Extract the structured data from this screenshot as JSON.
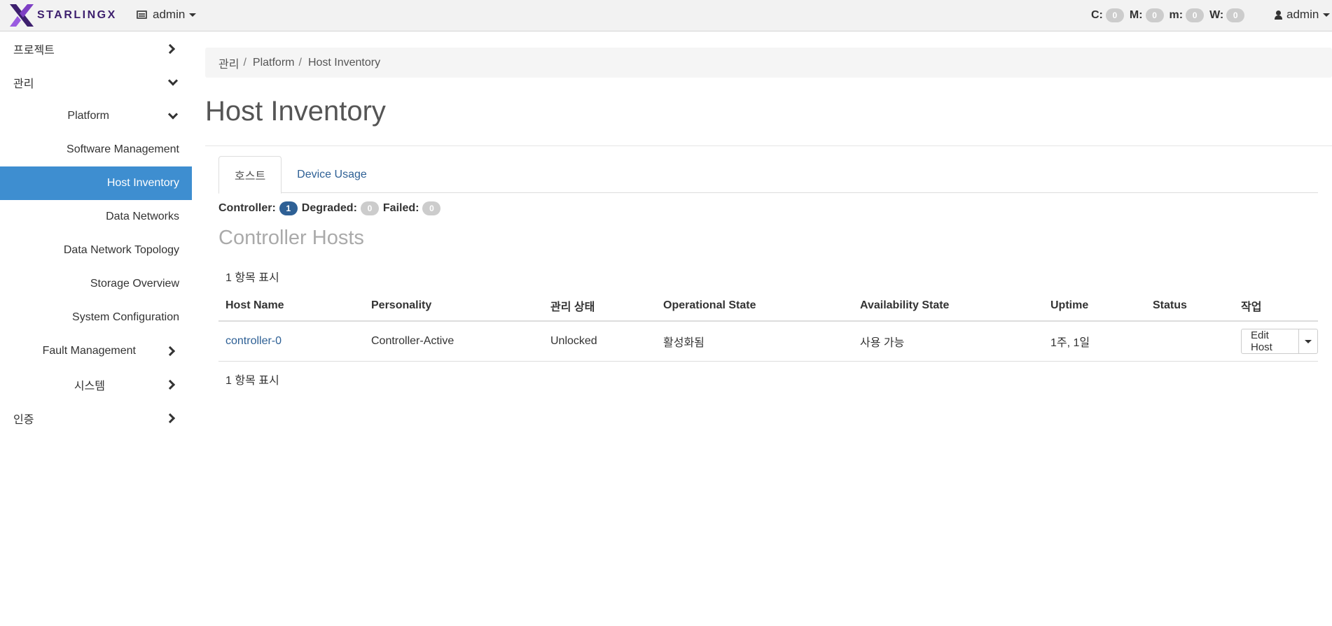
{
  "navbar": {
    "brand": "STARLINGX",
    "project": "admin",
    "alarms": [
      {
        "label": "C:",
        "count": "0"
      },
      {
        "label": "M:",
        "count": "0"
      },
      {
        "label": "m:",
        "count": "0"
      },
      {
        "label": "W:",
        "count": "0"
      }
    ],
    "user": "admin"
  },
  "sidebar": {
    "items": [
      {
        "label": "프로젝트"
      },
      {
        "label": "관리"
      },
      {
        "label": "Platform"
      },
      {
        "label": "Software Management"
      },
      {
        "label": "Host Inventory"
      },
      {
        "label": "Data Networks"
      },
      {
        "label": "Data Network Topology"
      },
      {
        "label": "Storage Overview"
      },
      {
        "label": "System Configuration"
      },
      {
        "label": "Fault Management"
      },
      {
        "label": "시스템"
      },
      {
        "label": "인증"
      }
    ]
  },
  "breadcrumb": [
    "관리",
    "Platform",
    "Host Inventory"
  ],
  "page_title": "Host Inventory",
  "tabs": [
    "호스트",
    "Device Usage"
  ],
  "summary": {
    "controller_label": "Controller:",
    "controller_count": "1",
    "degraded_label": "Degraded:",
    "degraded_count": "0",
    "failed_label": "Failed:",
    "failed_count": "0"
  },
  "section_title": "Controller Hosts",
  "count_text": "1 항목 표시",
  "table": {
    "headers": [
      "Host Name",
      "Personality",
      "관리 상태",
      "Operational State",
      "Availability State",
      "Uptime",
      "Status",
      "작업"
    ],
    "rows": [
      {
        "host_name": "controller-0",
        "personality": "Controller-Active",
        "admin_state": "Unlocked",
        "operational_state": "활성화됨",
        "availability_state": "사용 가능",
        "uptime": "1주, 1일",
        "status": "",
        "action": "Edit Host"
      }
    ]
  },
  "colors": {
    "accent": "#3e8ed0",
    "link": "#2e6095",
    "brand": "#3d1f6e"
  }
}
